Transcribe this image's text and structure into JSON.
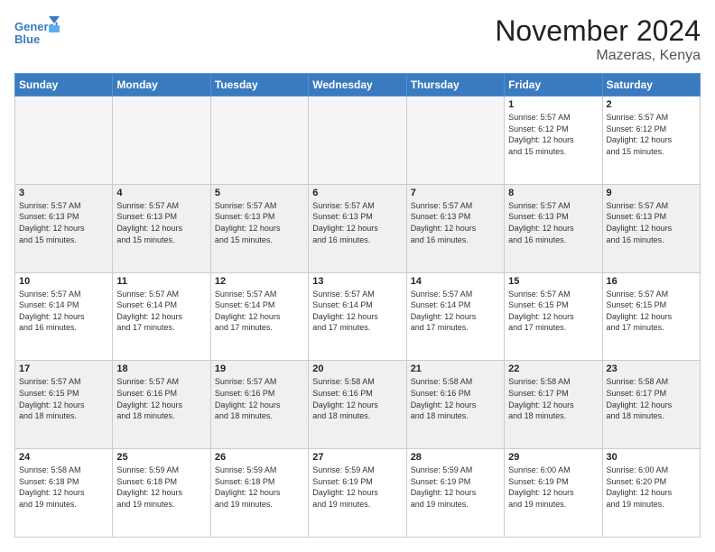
{
  "logo": {
    "line1": "General",
    "line2": "Blue"
  },
  "title": "November 2024",
  "subtitle": "Mazeras, Kenya",
  "days_of_week": [
    "Sunday",
    "Monday",
    "Tuesday",
    "Wednesday",
    "Thursday",
    "Friday",
    "Saturday"
  ],
  "weeks": [
    [
      {
        "day": "",
        "info": "",
        "empty": true
      },
      {
        "day": "",
        "info": "",
        "empty": true
      },
      {
        "day": "",
        "info": "",
        "empty": true
      },
      {
        "day": "",
        "info": "",
        "empty": true
      },
      {
        "day": "",
        "info": "",
        "empty": true
      },
      {
        "day": "1",
        "info": "Sunrise: 5:57 AM\nSunset: 6:12 PM\nDaylight: 12 hours\nand 15 minutes."
      },
      {
        "day": "2",
        "info": "Sunrise: 5:57 AM\nSunset: 6:12 PM\nDaylight: 12 hours\nand 15 minutes."
      }
    ],
    [
      {
        "day": "3",
        "info": "Sunrise: 5:57 AM\nSunset: 6:13 PM\nDaylight: 12 hours\nand 15 minutes."
      },
      {
        "day": "4",
        "info": "Sunrise: 5:57 AM\nSunset: 6:13 PM\nDaylight: 12 hours\nand 15 minutes."
      },
      {
        "day": "5",
        "info": "Sunrise: 5:57 AM\nSunset: 6:13 PM\nDaylight: 12 hours\nand 15 minutes."
      },
      {
        "day": "6",
        "info": "Sunrise: 5:57 AM\nSunset: 6:13 PM\nDaylight: 12 hours\nand 16 minutes."
      },
      {
        "day": "7",
        "info": "Sunrise: 5:57 AM\nSunset: 6:13 PM\nDaylight: 12 hours\nand 16 minutes."
      },
      {
        "day": "8",
        "info": "Sunrise: 5:57 AM\nSunset: 6:13 PM\nDaylight: 12 hours\nand 16 minutes."
      },
      {
        "day": "9",
        "info": "Sunrise: 5:57 AM\nSunset: 6:13 PM\nDaylight: 12 hours\nand 16 minutes."
      }
    ],
    [
      {
        "day": "10",
        "info": "Sunrise: 5:57 AM\nSunset: 6:14 PM\nDaylight: 12 hours\nand 16 minutes."
      },
      {
        "day": "11",
        "info": "Sunrise: 5:57 AM\nSunset: 6:14 PM\nDaylight: 12 hours\nand 17 minutes."
      },
      {
        "day": "12",
        "info": "Sunrise: 5:57 AM\nSunset: 6:14 PM\nDaylight: 12 hours\nand 17 minutes."
      },
      {
        "day": "13",
        "info": "Sunrise: 5:57 AM\nSunset: 6:14 PM\nDaylight: 12 hours\nand 17 minutes."
      },
      {
        "day": "14",
        "info": "Sunrise: 5:57 AM\nSunset: 6:14 PM\nDaylight: 12 hours\nand 17 minutes."
      },
      {
        "day": "15",
        "info": "Sunrise: 5:57 AM\nSunset: 6:15 PM\nDaylight: 12 hours\nand 17 minutes."
      },
      {
        "day": "16",
        "info": "Sunrise: 5:57 AM\nSunset: 6:15 PM\nDaylight: 12 hours\nand 17 minutes."
      }
    ],
    [
      {
        "day": "17",
        "info": "Sunrise: 5:57 AM\nSunset: 6:15 PM\nDaylight: 12 hours\nand 18 minutes."
      },
      {
        "day": "18",
        "info": "Sunrise: 5:57 AM\nSunset: 6:16 PM\nDaylight: 12 hours\nand 18 minutes."
      },
      {
        "day": "19",
        "info": "Sunrise: 5:57 AM\nSunset: 6:16 PM\nDaylight: 12 hours\nand 18 minutes."
      },
      {
        "day": "20",
        "info": "Sunrise: 5:58 AM\nSunset: 6:16 PM\nDaylight: 12 hours\nand 18 minutes."
      },
      {
        "day": "21",
        "info": "Sunrise: 5:58 AM\nSunset: 6:16 PM\nDaylight: 12 hours\nand 18 minutes."
      },
      {
        "day": "22",
        "info": "Sunrise: 5:58 AM\nSunset: 6:17 PM\nDaylight: 12 hours\nand 18 minutes."
      },
      {
        "day": "23",
        "info": "Sunrise: 5:58 AM\nSunset: 6:17 PM\nDaylight: 12 hours\nand 18 minutes."
      }
    ],
    [
      {
        "day": "24",
        "info": "Sunrise: 5:58 AM\nSunset: 6:18 PM\nDaylight: 12 hours\nand 19 minutes."
      },
      {
        "day": "25",
        "info": "Sunrise: 5:59 AM\nSunset: 6:18 PM\nDaylight: 12 hours\nand 19 minutes."
      },
      {
        "day": "26",
        "info": "Sunrise: 5:59 AM\nSunset: 6:18 PM\nDaylight: 12 hours\nand 19 minutes."
      },
      {
        "day": "27",
        "info": "Sunrise: 5:59 AM\nSunset: 6:19 PM\nDaylight: 12 hours\nand 19 minutes."
      },
      {
        "day": "28",
        "info": "Sunrise: 5:59 AM\nSunset: 6:19 PM\nDaylight: 12 hours\nand 19 minutes."
      },
      {
        "day": "29",
        "info": "Sunrise: 6:00 AM\nSunset: 6:19 PM\nDaylight: 12 hours\nand 19 minutes."
      },
      {
        "day": "30",
        "info": "Sunrise: 6:00 AM\nSunset: 6:20 PM\nDaylight: 12 hours\nand 19 minutes."
      }
    ]
  ]
}
